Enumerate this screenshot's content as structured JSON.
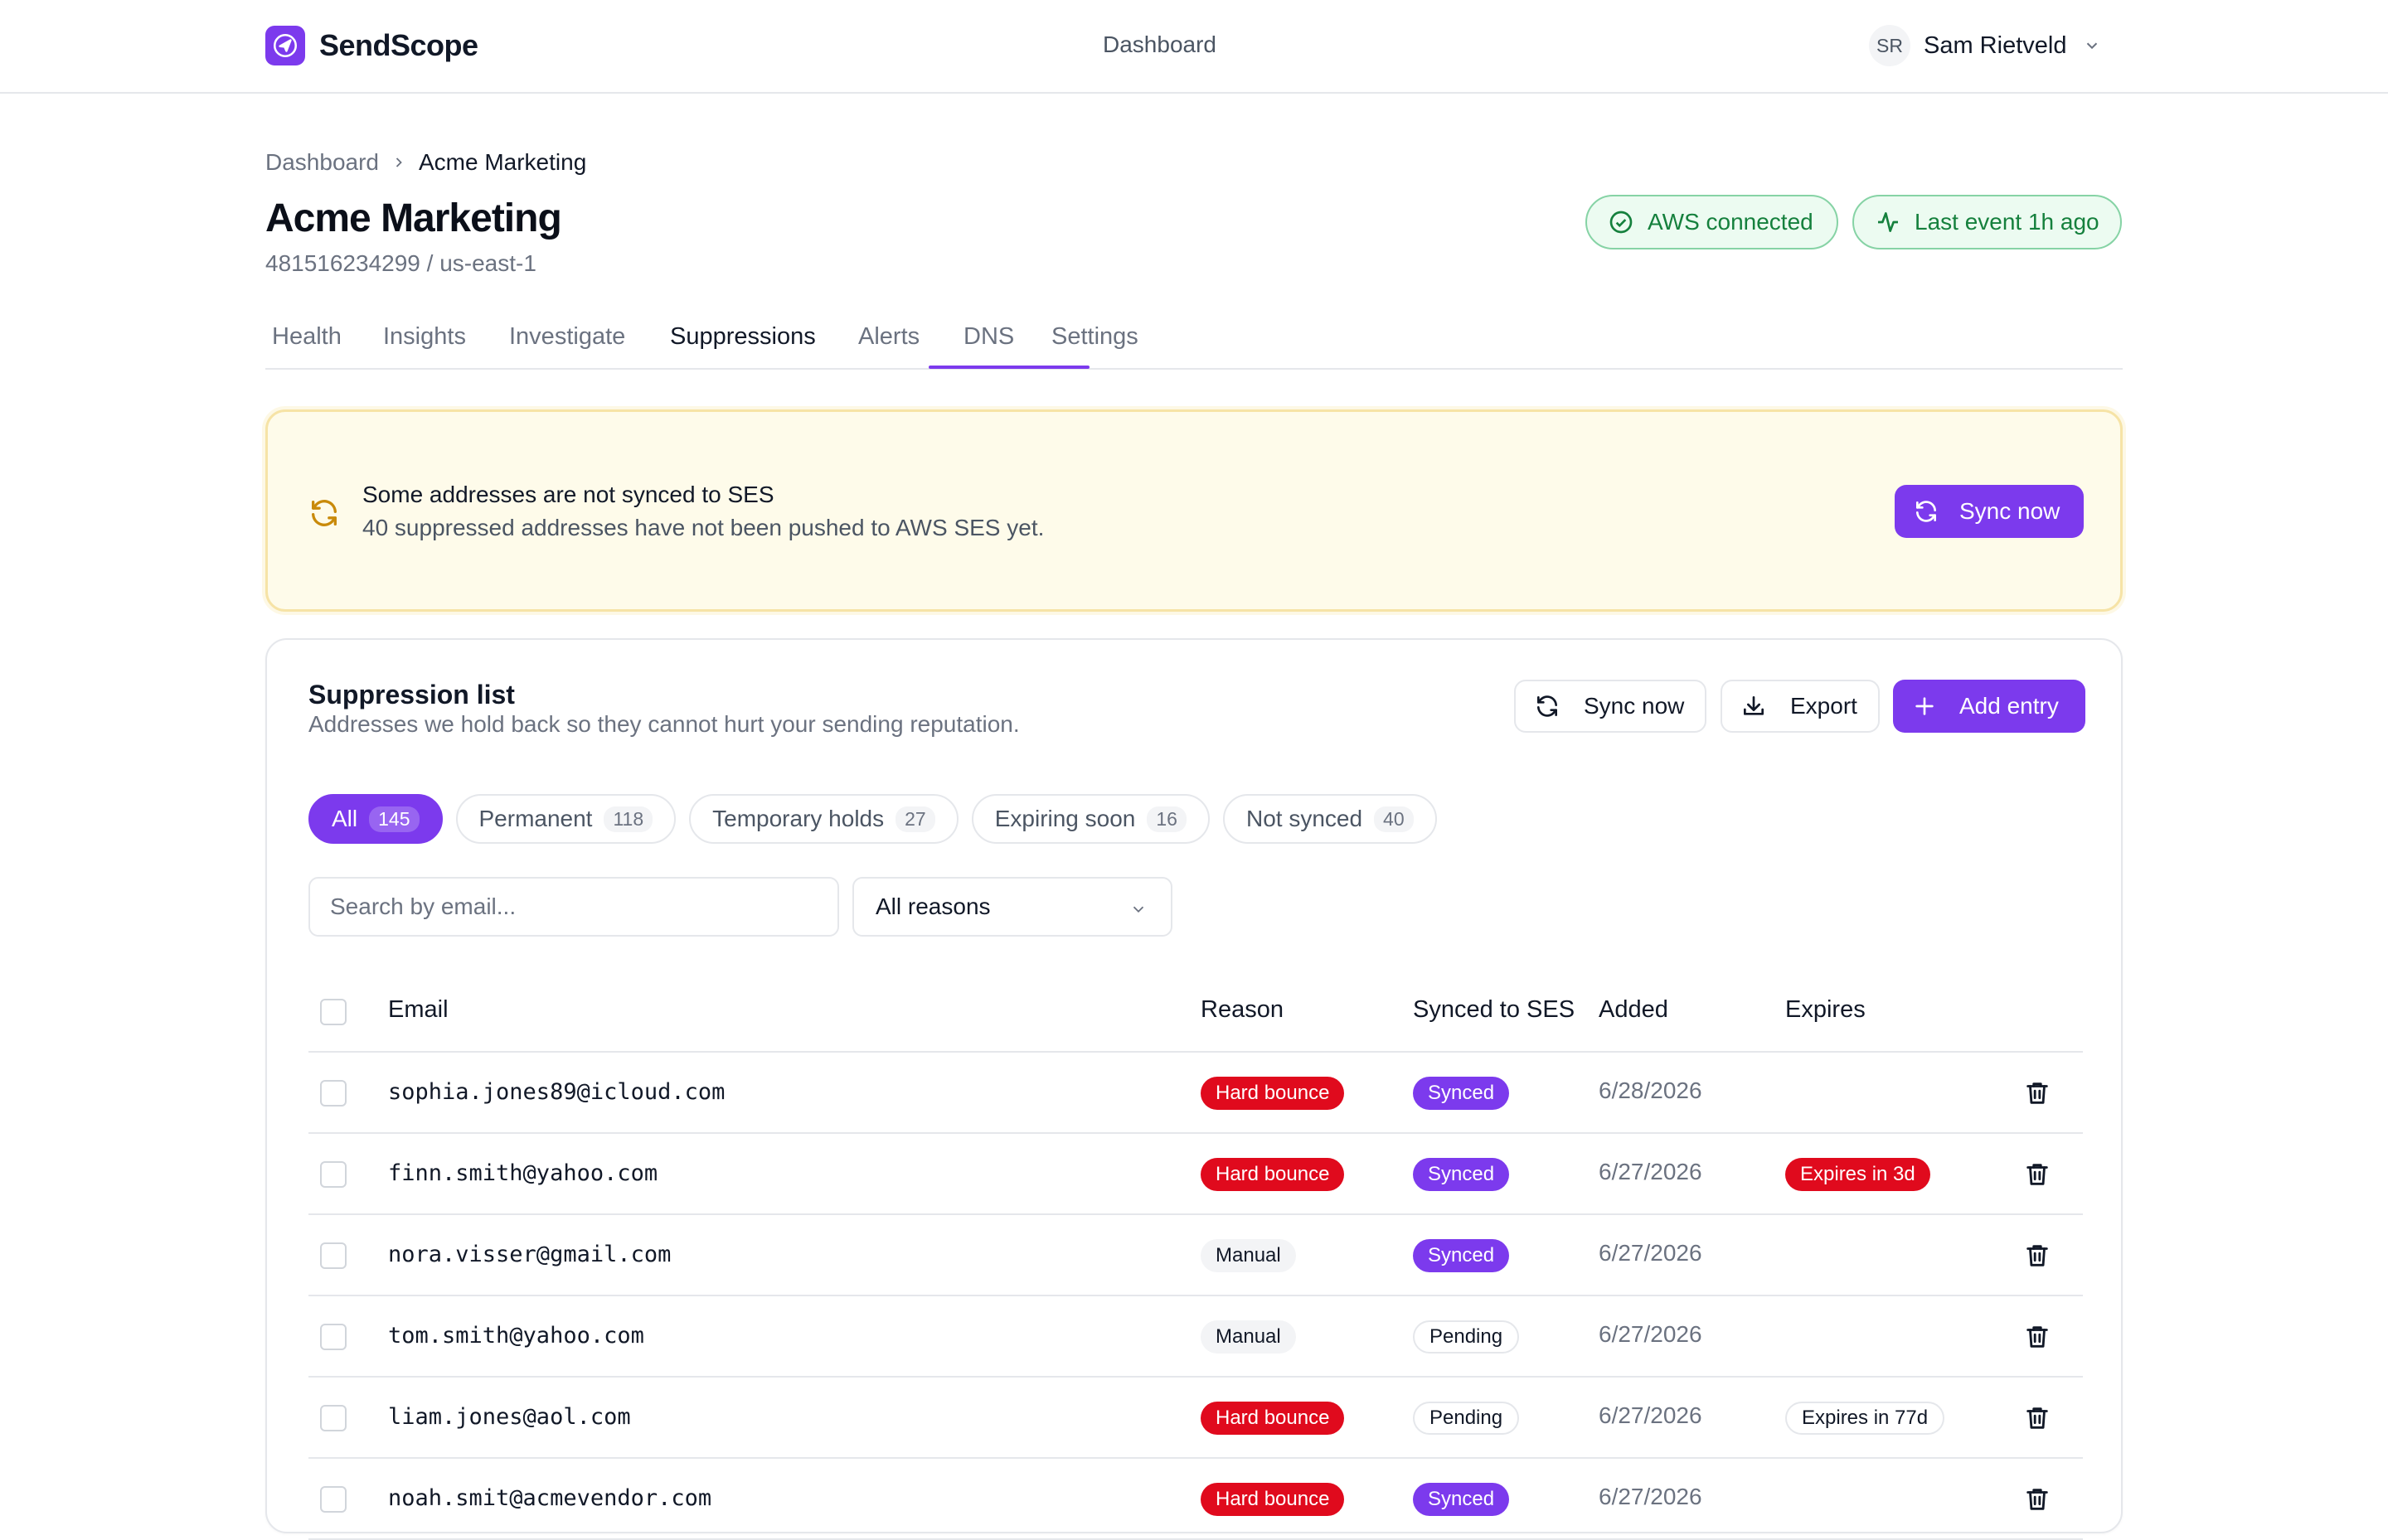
{
  "app": {
    "name": "SendScope"
  },
  "topnav": {
    "dashboard": "Dashboard"
  },
  "user": {
    "initials": "SR",
    "name": "Sam Rietveld"
  },
  "breadcrumb": {
    "root": "Dashboard",
    "current": "Acme Marketing"
  },
  "header": {
    "title": "Acme Marketing",
    "subtitle": "481516234299 / us-east-1",
    "status_aws": "AWS connected",
    "status_event": "Last event 1h ago"
  },
  "tabs": [
    "Health",
    "Insights",
    "Investigate",
    "Suppressions",
    "Alerts",
    "DNS",
    "Settings"
  ],
  "active_tab": "Suppressions",
  "banner": {
    "title": "Some addresses are not synced to SES",
    "text": "40 suppressed addresses have not been pushed to AWS SES yet.",
    "button": "Sync now"
  },
  "card": {
    "title": "Suppression list",
    "subtitle": "Addresses we hold back so they cannot hurt your sending reputation.",
    "sync_button": "Sync now",
    "export_button": "Export",
    "add_button": "Add entry"
  },
  "filters": [
    {
      "label": "All",
      "count": "145"
    },
    {
      "label": "Permanent",
      "count": "118"
    },
    {
      "label": "Temporary holds",
      "count": "27"
    },
    {
      "label": "Expiring soon",
      "count": "16"
    },
    {
      "label": "Not synced",
      "count": "40"
    }
  ],
  "search": {
    "placeholder": "Search by email...",
    "value": ""
  },
  "reason_select": {
    "selected": "All reasons"
  },
  "table": {
    "headers": {
      "email": "Email",
      "reason": "Reason",
      "synced": "Synced to SES",
      "added": "Added",
      "expires": "Expires"
    },
    "rows": [
      {
        "email": "sophia.jones89@icloud.com",
        "reason": "Hard bounce",
        "synced": "Synced",
        "added": "6/28/2026",
        "expires": ""
      },
      {
        "email": "finn.smith@yahoo.com",
        "reason": "Hard bounce",
        "synced": "Synced",
        "added": "6/27/2026",
        "expires": "Expires in 3d"
      },
      {
        "email": "nora.visser@gmail.com",
        "reason": "Manual",
        "synced": "Synced",
        "added": "6/27/2026",
        "expires": ""
      },
      {
        "email": "tom.smith@yahoo.com",
        "reason": "Manual",
        "synced": "Pending",
        "added": "6/27/2026",
        "expires": ""
      },
      {
        "email": "liam.jones@aol.com",
        "reason": "Hard bounce",
        "synced": "Pending",
        "added": "6/27/2026",
        "expires": "Expires in 77d"
      },
      {
        "email": "noah.smit@acmevendor.com",
        "reason": "Hard bounce",
        "synced": "Synced",
        "added": "6/27/2026",
        "expires": ""
      }
    ]
  },
  "colors": {
    "accent": "#7c3aed",
    "danger": "#e00a1d",
    "success": "#15803d",
    "warning_bg": "#fefbea"
  },
  "icons": {
    "logo": "paper-plane-icon",
    "user_menu": "chevron-down-icon",
    "breadcrumb_sep": "chevron-right-icon",
    "aws": "check-circle-icon",
    "event": "activity-icon",
    "sync": "refresh-icon",
    "export": "download-icon",
    "add": "plus-icon",
    "select": "chevron-down-icon",
    "delete": "trash-icon"
  }
}
